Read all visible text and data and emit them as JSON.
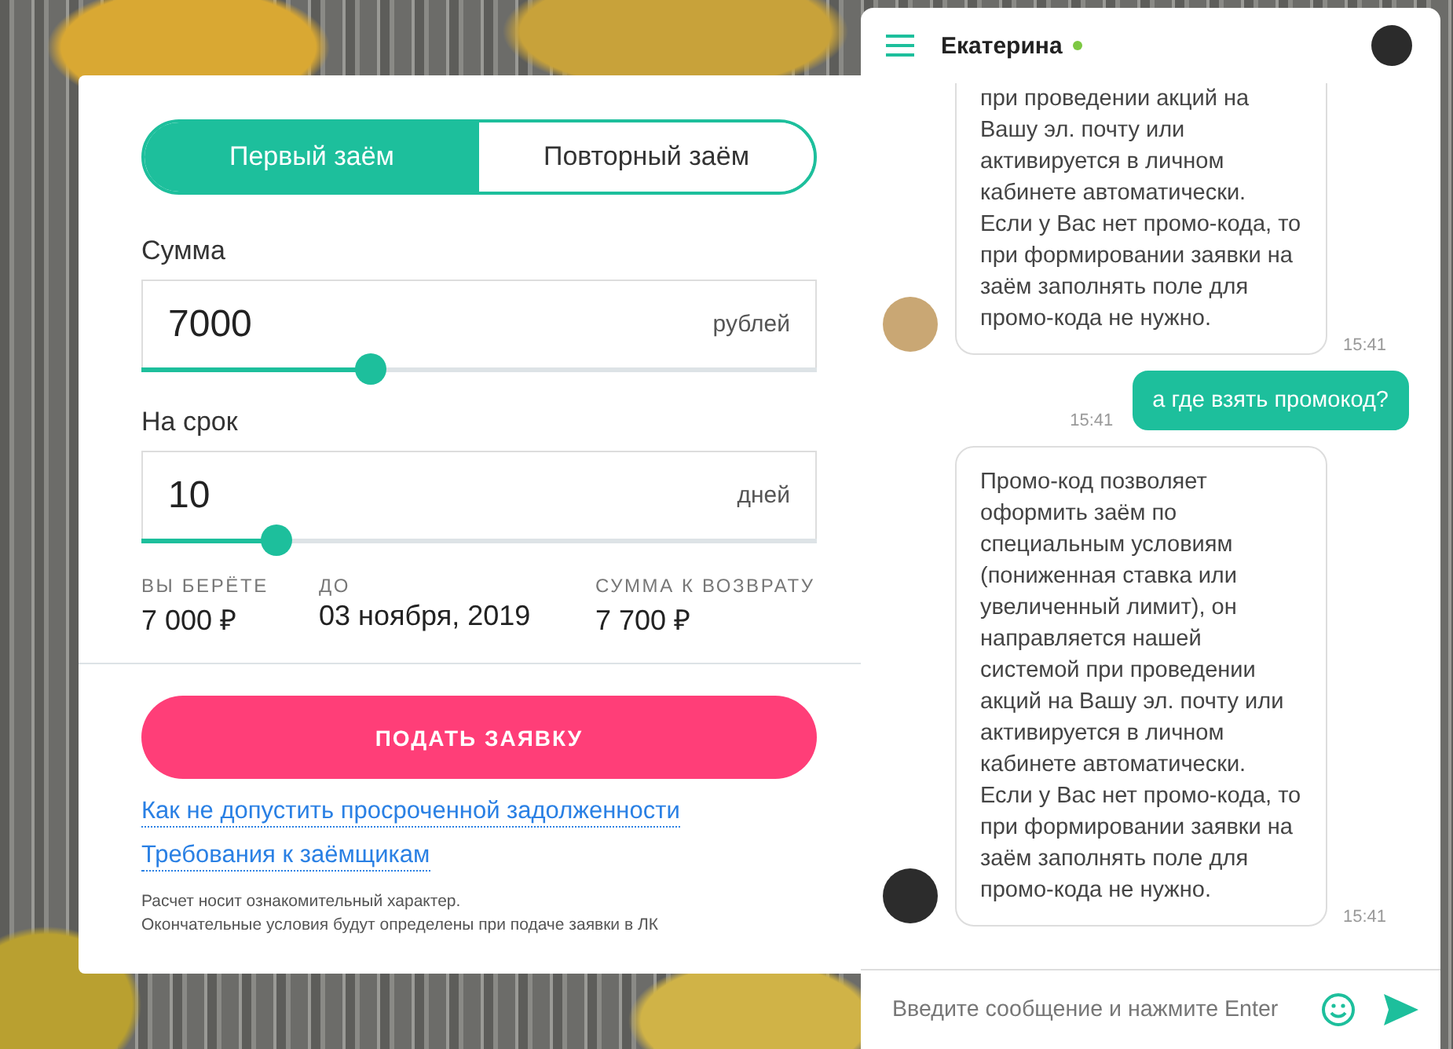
{
  "loan_tabs": [
    {
      "label": "Первый заём",
      "selected": true
    },
    {
      "label": "Повторный заём",
      "selected": false
    }
  ],
  "sliders": [
    {
      "label": "Сумма",
      "value": "7000",
      "unit": "рублей",
      "level": 0.34
    },
    {
      "label": "На срок",
      "value": "10",
      "unit": "дней",
      "level": 0.2
    }
  ],
  "summary": [
    {
      "label": "ВЫ БЕРЁТЕ",
      "value": "7 000 ₽"
    },
    {
      "label": "ДО",
      "value": "03 ноября, 2019"
    },
    {
      "label": "СУММА К ВОЗВРАТУ",
      "value": "7 700 ₽"
    }
  ],
  "submit_button": "ПОДАТЬ ЗАЯВКУ",
  "links": [
    "Как не допустить просроченной задолженности",
    "Требования к заёмщикам"
  ],
  "disclaimer": [
    "Расчет носит ознакомительный характер.",
    "Окончательные условия будут определены при подаче заявки в ЛК"
  ],
  "chat": {
    "name": "Екатерина",
    "online": true,
    "messages": [
      {
        "kind": "in",
        "cut": true,
        "text": "при проведении акций на Вашу эл. почту или активируется в личном кабинете автоматически. Если у Вас нет промо-кода, то при формировании заявки на заём заполнять поле для промо-кода не нужно.",
        "time": "15:41"
      },
      {
        "kind": "out",
        "cut": false,
        "text": "а где взять промокод?",
        "time": "15:41"
      },
      {
        "kind": "in",
        "cut": false,
        "text": "Промо-код позволяет оформить заём по специальным условиям (пониженная ставка или увеличенный лимит), он направляется нашей системой при проведении акций на Вашу эл. почту или активируется в личном кабинете автоматически. Если у Вас нет промо-кода, то при формировании заявки на заём заполнять поле для промо-кода не нужно.",
        "time": "15:41"
      }
    ],
    "input_placeholder": "Введите сообщение и нажмите Enter"
  }
}
